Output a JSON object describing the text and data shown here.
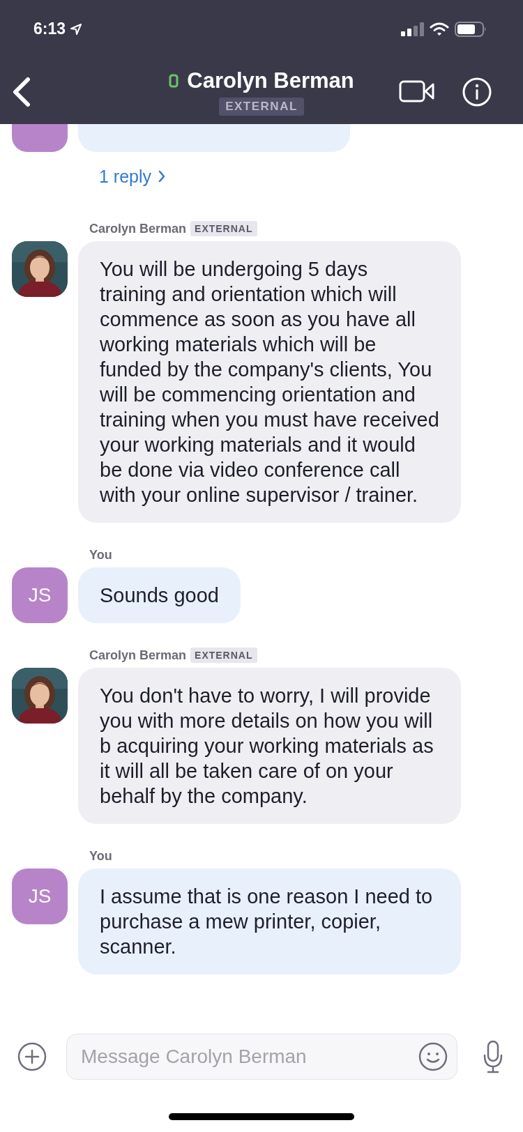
{
  "status_bar": {
    "time": "6:13"
  },
  "header": {
    "title": "Carolyn Berman",
    "online": true,
    "badge": "EXTERNAL"
  },
  "messages": [
    {
      "kind": "outgoing",
      "avatar": {
        "kind": "initials"
      },
      "thread": "1 reply"
    },
    {
      "kind": "incoming",
      "sender": "Carolyn Berman",
      "badge": "EXTERNAL",
      "text": "You will be undergoing 5 days training and orientation which will commence as soon as you have all working materials which will be funded by the company's clients, You will be commencing orientation and training when you must have received your working materials and it would be done via video conference call with your online supervisor / trainer."
    },
    {
      "kind": "outgoing",
      "sender": "You",
      "avatar": {
        "kind": "initials",
        "text": "JS"
      },
      "text": "Sounds good"
    },
    {
      "kind": "incoming",
      "sender": "Carolyn Berman",
      "badge": "EXTERNAL",
      "text": "You don't have to worry, I will provide you with more details on how you will b acquiring your working materials as it will all be taken care of on your behalf by the company."
    },
    {
      "kind": "outgoing",
      "sender": "You",
      "avatar": {
        "kind": "initials",
        "text": "JS"
      },
      "text": "I assume that is one reason I need to purchase a mew printer, copier, scanner."
    }
  ],
  "composer": {
    "placeholder": "Message Carolyn Berman"
  }
}
